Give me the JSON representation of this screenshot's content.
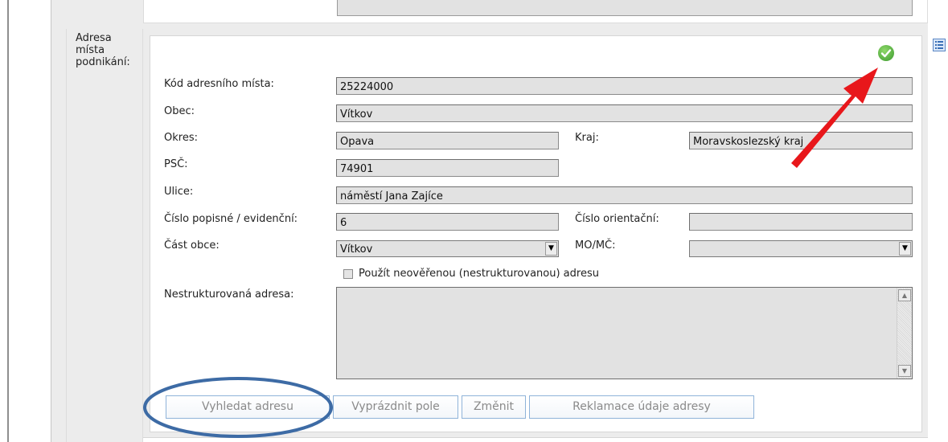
{
  "section": {
    "label": "Adresa místa podnikání:"
  },
  "fields": {
    "kod_label": "Kód adresního místa:",
    "kod_value": "25224000",
    "obec_label": "Obec:",
    "obec_value": "Vítkov",
    "okres_label": "Okres:",
    "okres_value": "Opava",
    "kraj_label": "Kraj:",
    "kraj_value": "Moravskoslezský kraj",
    "psc_label": "PSČ:",
    "psc_value": "74901",
    "ulice_label": "Ulice:",
    "ulice_value": "náměstí Jana Zajíce",
    "cislo_pop_label": "Číslo popisné / evidenční:",
    "cislo_pop_value": "6",
    "cislo_or_label": "Číslo orientační:",
    "cislo_or_value": "",
    "cast_obce_label": "Část obce:",
    "cast_obce_value": "Vítkov",
    "mo_mc_label": "MO/MČ:",
    "mo_mc_value": "",
    "checkbox_label": "Použít neověřenou (nestrukturovanou) adresu",
    "nestrukt_label": "Nestrukturovaná adresa:",
    "nestrukt_value": ""
  },
  "buttons": {
    "vyhledat": "Vyhledat adresu",
    "vyprazdnit": "Vyprázdnit pole",
    "zmenit": "Změnit",
    "reklamace": "Reklamace údaje adresy"
  },
  "icons": {
    "status": "check-circle-icon",
    "list": "list-icon",
    "dropdown": "chevron-down-icon"
  },
  "colors": {
    "field_bg": "#e2e2e2",
    "button_border": "#8fb3d9",
    "annotation_arrow": "#e8171b",
    "annotation_ellipse": "#3d6ba5",
    "check": "#3b9a2e"
  }
}
